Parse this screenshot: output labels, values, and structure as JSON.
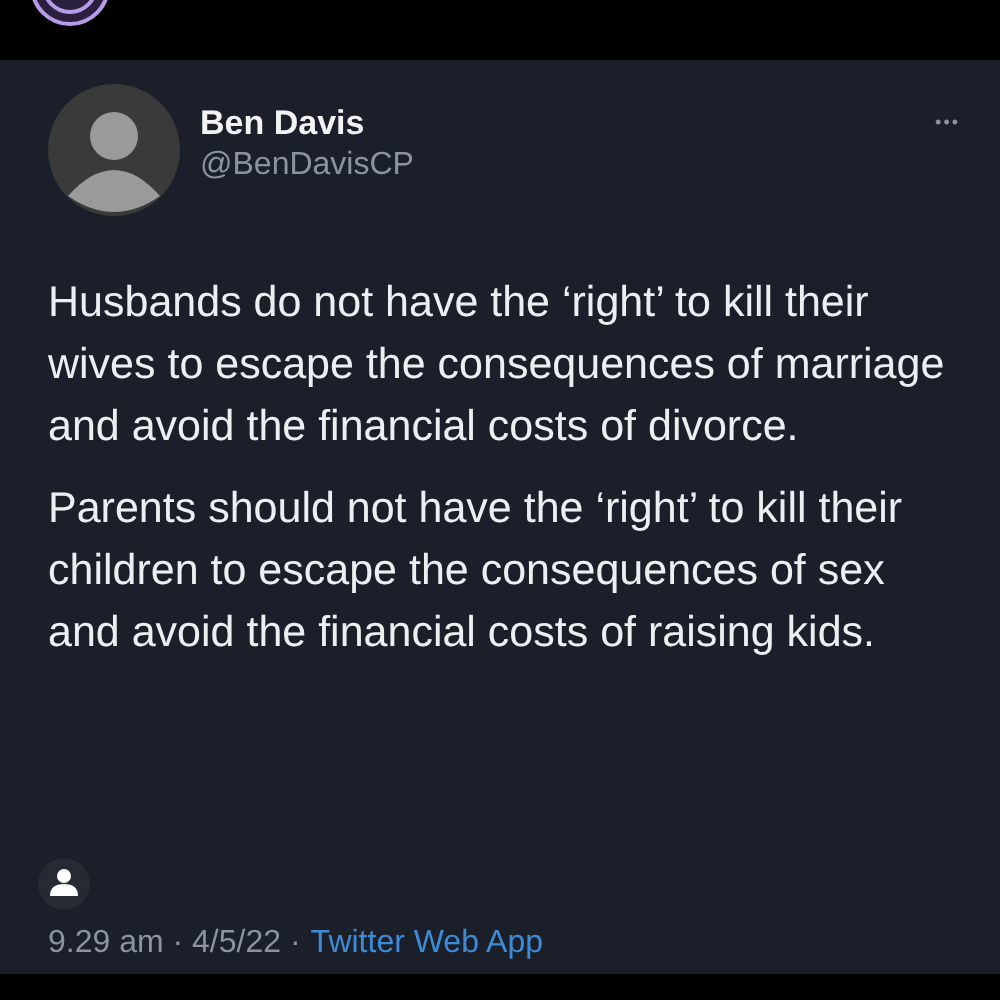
{
  "tweet": {
    "author": {
      "name": "Ben Davis",
      "handle": "@BenDavisCP"
    },
    "menu": "•••",
    "paragraphs": [
      "Husbands do not have the ‘right’ to kill their wives to escape the consequences of marriage and avoid the financial costs of divorce.",
      "Parents should not have the ‘right’ to kill their children to escape the consequences of sex and avoid the financial costs of raising kids."
    ],
    "timestamp": "9.29 am · 4/5/22 ·",
    "source": "Twitter Web App"
  }
}
